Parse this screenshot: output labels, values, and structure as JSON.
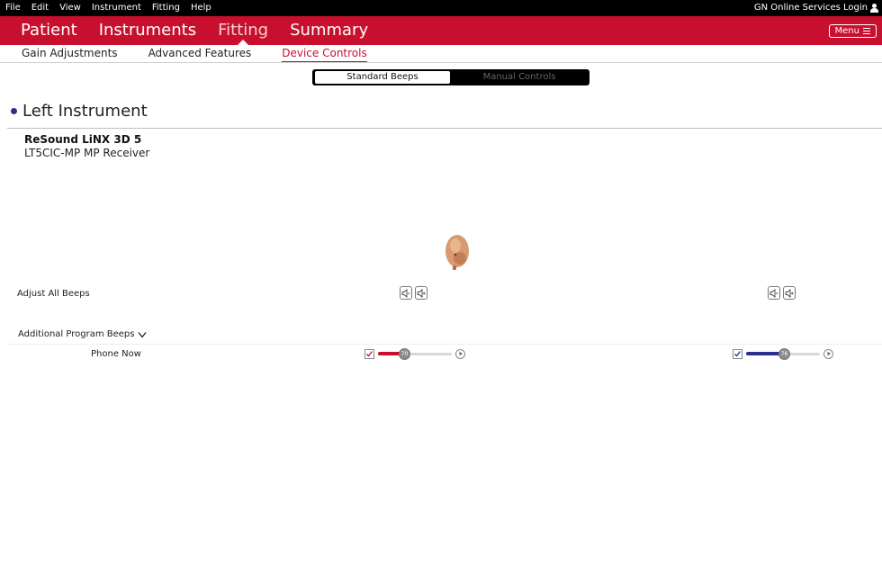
{
  "menubar": {
    "items": [
      "File",
      "Edit",
      "View",
      "Instrument",
      "Fitting",
      "Help"
    ],
    "login": "GN Online Services Login"
  },
  "main_tabs": {
    "items": [
      "Patient",
      "Instruments",
      "Fitting",
      "Summary"
    ],
    "active": "Fitting",
    "menu_label": "Menu"
  },
  "sub_tabs": {
    "items": [
      "Gain Adjustments",
      "Advanced Features",
      "Device Controls"
    ],
    "active": "Device Controls"
  },
  "mode_toggle": {
    "selected": "Standard Beeps",
    "other": "Manual Controls"
  },
  "section": {
    "title": "Left Instrument",
    "device_name": "ReSound LiNX 3D 5",
    "device_model": "LT5CIC-MP  MP Receiver"
  },
  "controls": {
    "adjust_all_label": "Adjust All Beeps",
    "additional_label": "Additional Program Beeps",
    "phone_label": "Phone Now",
    "left_slider": {
      "value": "70",
      "level": 0.33,
      "checked": true
    },
    "right_slider": {
      "value": "76",
      "level": 0.52,
      "checked": true
    }
  },
  "colors": {
    "brand_red": "#c8102e",
    "right_blue": "#2b2f8f",
    "left_red": "#c8102e"
  }
}
